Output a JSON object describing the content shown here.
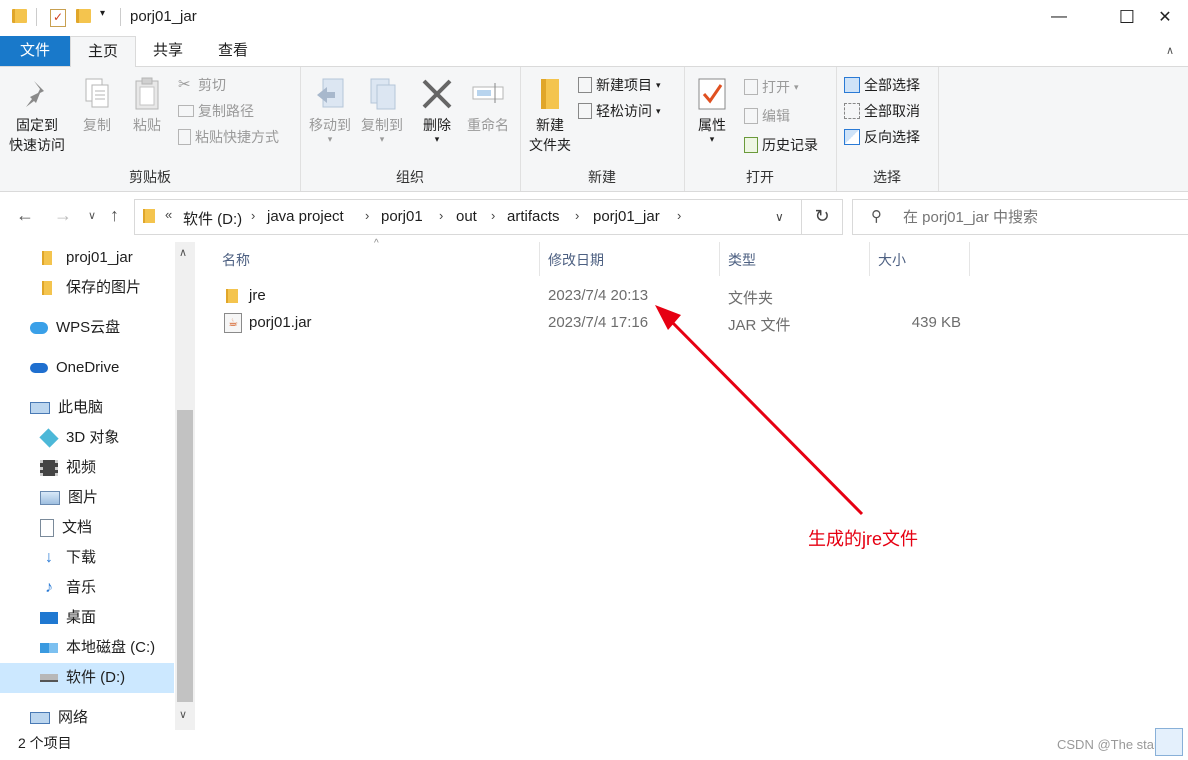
{
  "window": {
    "title": "porj01_jar",
    "minimize": "—",
    "maximize": "☐",
    "close": "✕"
  },
  "ribbon_tabs": [
    "文件",
    "主页",
    "共享",
    "查看"
  ],
  "ribbon": {
    "clipboard": {
      "pin_line1": "固定到",
      "pin_line2": "快速访问",
      "copy": "复制",
      "paste": "粘贴",
      "cut": "剪切",
      "copy_path": "复制路径",
      "paste_shortcut": "粘贴快捷方式",
      "label": "剪贴板"
    },
    "organize": {
      "move_to": "移动到",
      "copy_to": "复制到",
      "delete": "删除",
      "rename": "重命名",
      "label": "组织"
    },
    "new": {
      "new_folder_line1": "新建",
      "new_folder_line2": "文件夹",
      "new_item": "新建项目",
      "easy_access": "轻松访问",
      "label": "新建"
    },
    "open": {
      "properties": "属性",
      "open": "打开",
      "edit": "编辑",
      "history": "历史记录",
      "label": "打开"
    },
    "select": {
      "select_all": "全部选择",
      "select_none": "全部取消",
      "invert": "反向选择",
      "label": "选择"
    }
  },
  "address": {
    "overflow": "«",
    "crumbs": [
      "软件 (D:)",
      "java project",
      "porj01",
      "out",
      "artifacts",
      "porj01_jar"
    ]
  },
  "search": {
    "placeholder": "在 porj01_jar 中搜索"
  },
  "nav_pane": {
    "items": [
      "proj01_jar",
      "保存的图片",
      "WPS云盘",
      "OneDrive",
      "此电脑",
      "3D 对象",
      "视频",
      "图片",
      "文档",
      "下载",
      "音乐",
      "桌面",
      "本地磁盘 (C:)",
      "软件 (D:)",
      "网络"
    ],
    "selected": "软件 (D:)"
  },
  "columns": [
    "名称",
    "修改日期",
    "类型",
    "大小"
  ],
  "files": [
    {
      "name": "jre",
      "modified": "2023/7/4 20:13",
      "type": "文件夹",
      "size": "",
      "icon": "folder-icon"
    },
    {
      "name": "porj01.jar",
      "modified": "2023/7/4 17:16",
      "type": "JAR 文件",
      "size": "439 KB",
      "icon": "jar-file-icon"
    }
  ],
  "status": {
    "item_count": "2 个项目"
  },
  "annotation": {
    "text": "生成的jre文件",
    "color": "#e60012"
  },
  "watermark": "CSDN @The star"
}
